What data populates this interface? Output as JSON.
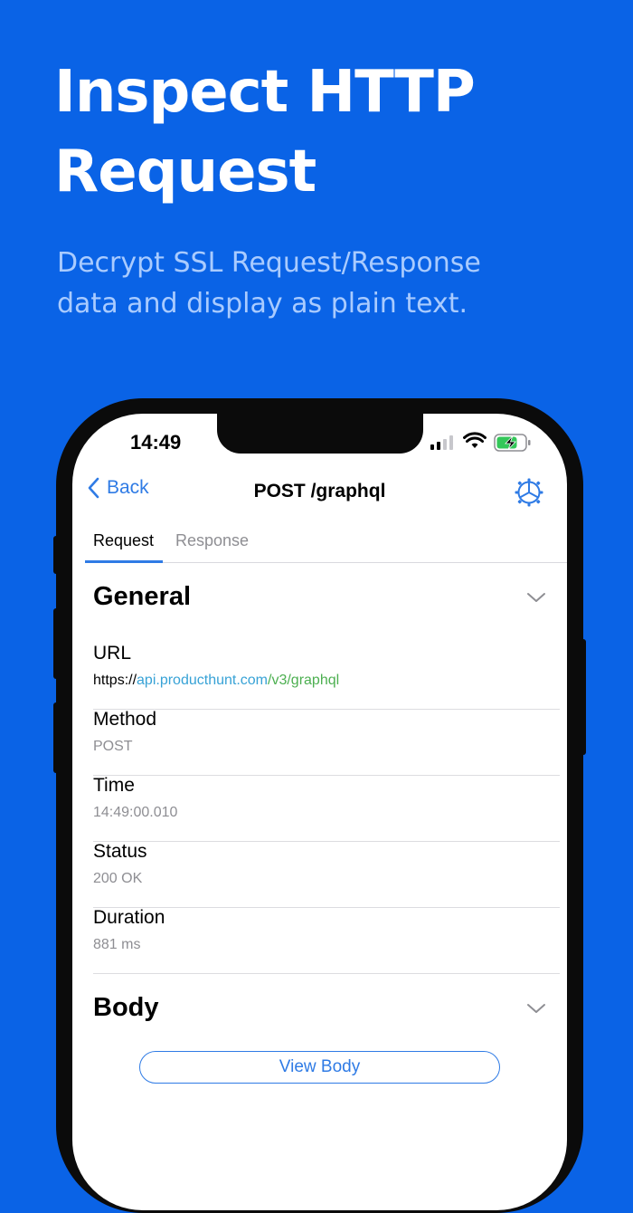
{
  "promo": {
    "headline_line1": "Inspect HTTP",
    "headline_line2": "Request",
    "subhead_line1": "Decrypt SSL Request/Response",
    "subhead_line2": "data and display as plain text."
  },
  "status_bar": {
    "time": "14:49"
  },
  "nav": {
    "back_label": "Back",
    "title": "POST /graphql"
  },
  "tabs": [
    {
      "label": "Request",
      "selected": true
    },
    {
      "label": "Response",
      "selected": false
    }
  ],
  "general": {
    "title": "General",
    "url_label": "URL",
    "url_scheme": "https://",
    "url_host": "api.producthunt.com",
    "url_path": "/v3/graphql",
    "fields": [
      {
        "label": "Method",
        "value": "POST"
      },
      {
        "label": "Time",
        "value": "14:49:00.010"
      },
      {
        "label": "Status",
        "value": "200 OK"
      },
      {
        "label": "Duration",
        "value": "881 ms"
      }
    ]
  },
  "body": {
    "title": "Body",
    "button_label": "View Body"
  },
  "colors": {
    "background": "#0A63E6",
    "accent": "#2F7BE5",
    "subhead": "#A9CBFF",
    "url_host": "#37A2D6",
    "url_path": "#4CAF50",
    "battery": "#34C759"
  }
}
